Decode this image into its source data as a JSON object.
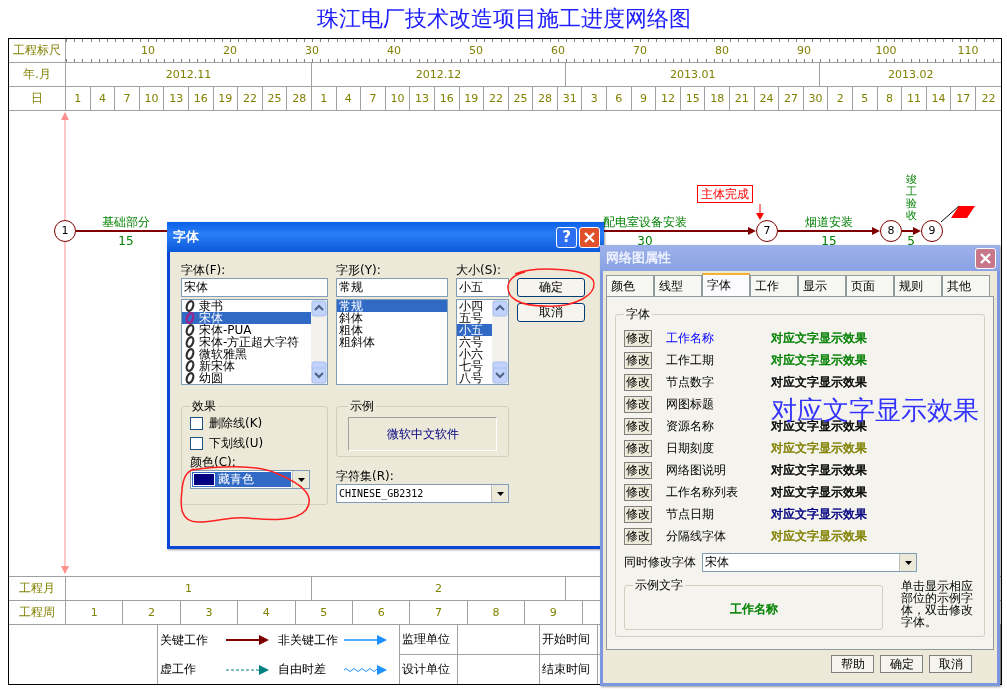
{
  "title": "珠江电厂技术改造项目施工进度网络图",
  "timescale": {
    "ruler_label": "工程标尺",
    "ruler_ticks": [
      "10",
      "20",
      "30",
      "40",
      "50",
      "60",
      "70",
      "80",
      "90",
      "100",
      "110"
    ],
    "month_label": "年.月",
    "months": [
      "2012.11",
      "2012.12",
      "2013.01",
      "2013.02"
    ],
    "day_label": "日",
    "days": [
      "1",
      "4",
      "7",
      "10",
      "13",
      "16",
      "19",
      "22",
      "25",
      "28",
      "1",
      "4",
      "7",
      "10",
      "13",
      "16",
      "19",
      "22",
      "25",
      "28",
      "31",
      "3",
      "6",
      "9",
      "12",
      "15",
      "18",
      "21",
      "24",
      "27",
      "30",
      "2",
      "5",
      "8",
      "11",
      "14",
      "17",
      "22"
    ]
  },
  "diagram": {
    "nodes": [
      {
        "label": "1"
      },
      {
        "label": "7"
      },
      {
        "label": "8"
      },
      {
        "label": "9"
      }
    ],
    "activities": [
      {
        "name": "基础部分",
        "duration": "15"
      },
      {
        "name": "配电室设备安装",
        "duration": "30"
      },
      {
        "name": "烟道安装",
        "duration": "15"
      },
      {
        "name": "竣工验收",
        "duration": "5"
      }
    ],
    "milestone": "主体完成"
  },
  "bottom": {
    "month_label": "工程月",
    "project_months": [
      "1",
      "2"
    ],
    "week_label": "工程周",
    "weeks": [
      "1",
      "2",
      "3",
      "4",
      "5",
      "6",
      "7",
      "8",
      "9"
    ]
  },
  "legend": {
    "items": [
      {
        "label": "关键工作",
        "kind": "critical"
      },
      {
        "label": "非关键工作",
        "kind": "noncritical"
      },
      {
        "label": "虚工作",
        "kind": "dummy"
      },
      {
        "label": "自由时差",
        "kind": "float"
      }
    ],
    "fields": [
      "监理单位",
      "开始时间",
      "设计单位",
      "结束时间"
    ]
  },
  "font_dialog": {
    "title": "字体",
    "help_button": "?",
    "font": {
      "label": "字体(F):",
      "value": "宋体",
      "items": [
        {
          "label": "隶书",
          "selected": false
        },
        {
          "label": "宋体",
          "selected": true
        },
        {
          "label": "宋体-PUA",
          "selected": false
        },
        {
          "label": "宋体-方正超大字符",
          "selected": false
        },
        {
          "label": "微软雅黑",
          "selected": false
        },
        {
          "label": "新宋体",
          "selected": false
        },
        {
          "label": "幼圆",
          "selected": false
        }
      ]
    },
    "style": {
      "label": "字形(Y):",
      "value": "常规",
      "items": [
        {
          "label": "常规",
          "selected": true
        },
        {
          "label": "斜体",
          "selected": false
        },
        {
          "label": "粗体",
          "selected": false
        },
        {
          "label": "粗斜体",
          "selected": false
        }
      ]
    },
    "size": {
      "label": "大小(S):",
      "value": "小五",
      "items": [
        {
          "label": "小四",
          "selected": false
        },
        {
          "label": "五号",
          "selected": false
        },
        {
          "label": "小五",
          "selected": true
        },
        {
          "label": "六号",
          "selected": false
        },
        {
          "label": "小六",
          "selected": false
        },
        {
          "label": "七号",
          "selected": false
        },
        {
          "label": "八号",
          "selected": false
        }
      ]
    },
    "buttons": [
      {
        "label": "确定",
        "circled": true
      },
      {
        "label": "取消",
        "circled": false
      }
    ],
    "effects": {
      "title": "效果",
      "options": [
        {
          "label": "删除线(K)",
          "checked": false
        },
        {
          "label": "下划线(U)",
          "checked": false
        }
      ],
      "color": {
        "label": "颜色(C):",
        "value": "藏青色",
        "color": "#000080",
        "circled": true
      }
    },
    "sample": {
      "title": "示例",
      "text": "微软中文软件"
    },
    "charset": {
      "label": "字符集(R):",
      "value": "CHINESE_GB2312"
    }
  },
  "props_dialog": {
    "title": "网络图属性",
    "tabs": [
      {
        "label": "颜色",
        "selected": false
      },
      {
        "label": "线型",
        "selected": false
      },
      {
        "label": "字体",
        "selected": true
      },
      {
        "label": "工作",
        "selected": false
      },
      {
        "label": "显示",
        "selected": false
      },
      {
        "label": "页面",
        "selected": false
      },
      {
        "label": "规则",
        "selected": false
      },
      {
        "label": "其他",
        "selected": false
      }
    ],
    "group_title": "字体",
    "rows": [
      {
        "button": "修改",
        "label": "工作名称",
        "selected": true,
        "sample": "对应文字显示效果",
        "color": "#008000",
        "kind": "normal"
      },
      {
        "button": "修改",
        "label": "工作工期",
        "selected": false,
        "sample": "对应文字显示效果",
        "color": "#008000",
        "kind": "normal"
      },
      {
        "button": "修改",
        "label": "节点数字",
        "selected": false,
        "sample": "对应文字显示效果",
        "color": "#000000",
        "kind": "normal"
      },
      {
        "button": "修改",
        "label": "网图标题",
        "selected": false,
        "sample": "对应文字显示效果",
        "color": "#3333ff",
        "kind": "large"
      },
      {
        "button": "修改",
        "label": "资源名称",
        "selected": false,
        "sample": "对应文字显示效果",
        "color": "#000000",
        "kind": "normal"
      },
      {
        "button": "修改",
        "label": "日期刻度",
        "selected": false,
        "sample": "对应文字显示效果",
        "color": "#808000",
        "kind": "normal"
      },
      {
        "button": "修改",
        "label": "网络图说明",
        "selected": false,
        "sample": "对应文字显示效果",
        "color": "#000000",
        "kind": "normal"
      },
      {
        "button": "修改",
        "label": "工作名称列表",
        "selected": false,
        "sample": "对应文字显示效果",
        "color": "#000000",
        "kind": "normal"
      },
      {
        "button": "修改",
        "label": "节点日期",
        "selected": false,
        "sample": "对应文字显示效果",
        "color": "#000080",
        "kind": "normal"
      },
      {
        "button": "修改",
        "label": "分隔线字体",
        "selected": false,
        "sample": "对应文字显示效果",
        "color": "#808000",
        "kind": "normal"
      }
    ],
    "same_font": {
      "label": "同时修改字体",
      "value": "宋体"
    },
    "preview": {
      "title": "示例文字",
      "text": "工作名称",
      "color": "#008000"
    },
    "hint": "单击显示相应部位的示例字体，双击修改字体。",
    "buttons": [
      "帮助",
      "确定",
      "取消"
    ]
  }
}
